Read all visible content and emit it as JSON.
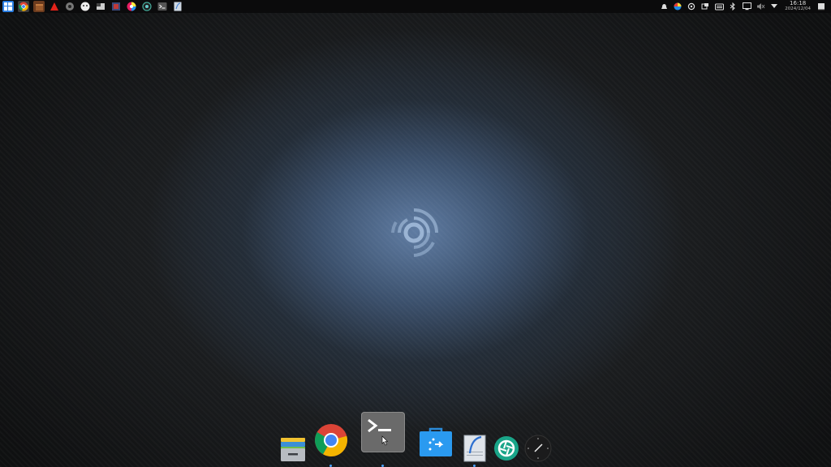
{
  "desktop": {
    "accent": "#4aa3ff"
  },
  "top_panel": {
    "left_launchers": [
      "start-menu-icon",
      "chrome-icon",
      "archive-manager-icon",
      "vivaldi-icon",
      "settings-icon",
      "dog-app-icon",
      "flag-app-icon",
      "disk-usage-icon",
      "color-picker-icon",
      "uget-icon",
      "terminal-icon",
      "text-editor-icon"
    ],
    "tray_icons": [
      "bell-icon",
      "color-app-icon",
      "power-icon",
      "display-icon",
      "keyboard-icon",
      "bluetooth-icon",
      "screen-icon",
      "volume-muted-icon",
      "chevron-down-icon"
    ],
    "clock": {
      "time": "16:18",
      "date": "2024/12/04"
    }
  },
  "dock": {
    "items": [
      {
        "name": "file-manager",
        "running": true
      },
      {
        "name": "chrome",
        "running": true
      },
      {
        "name": "terminal",
        "running": false,
        "hovered": true
      },
      {
        "name": "software-store",
        "running": true
      },
      {
        "name": "text-editor",
        "running": false
      },
      {
        "name": "screenshot",
        "running": false
      },
      {
        "name": "clock",
        "running": false
      }
    ]
  }
}
